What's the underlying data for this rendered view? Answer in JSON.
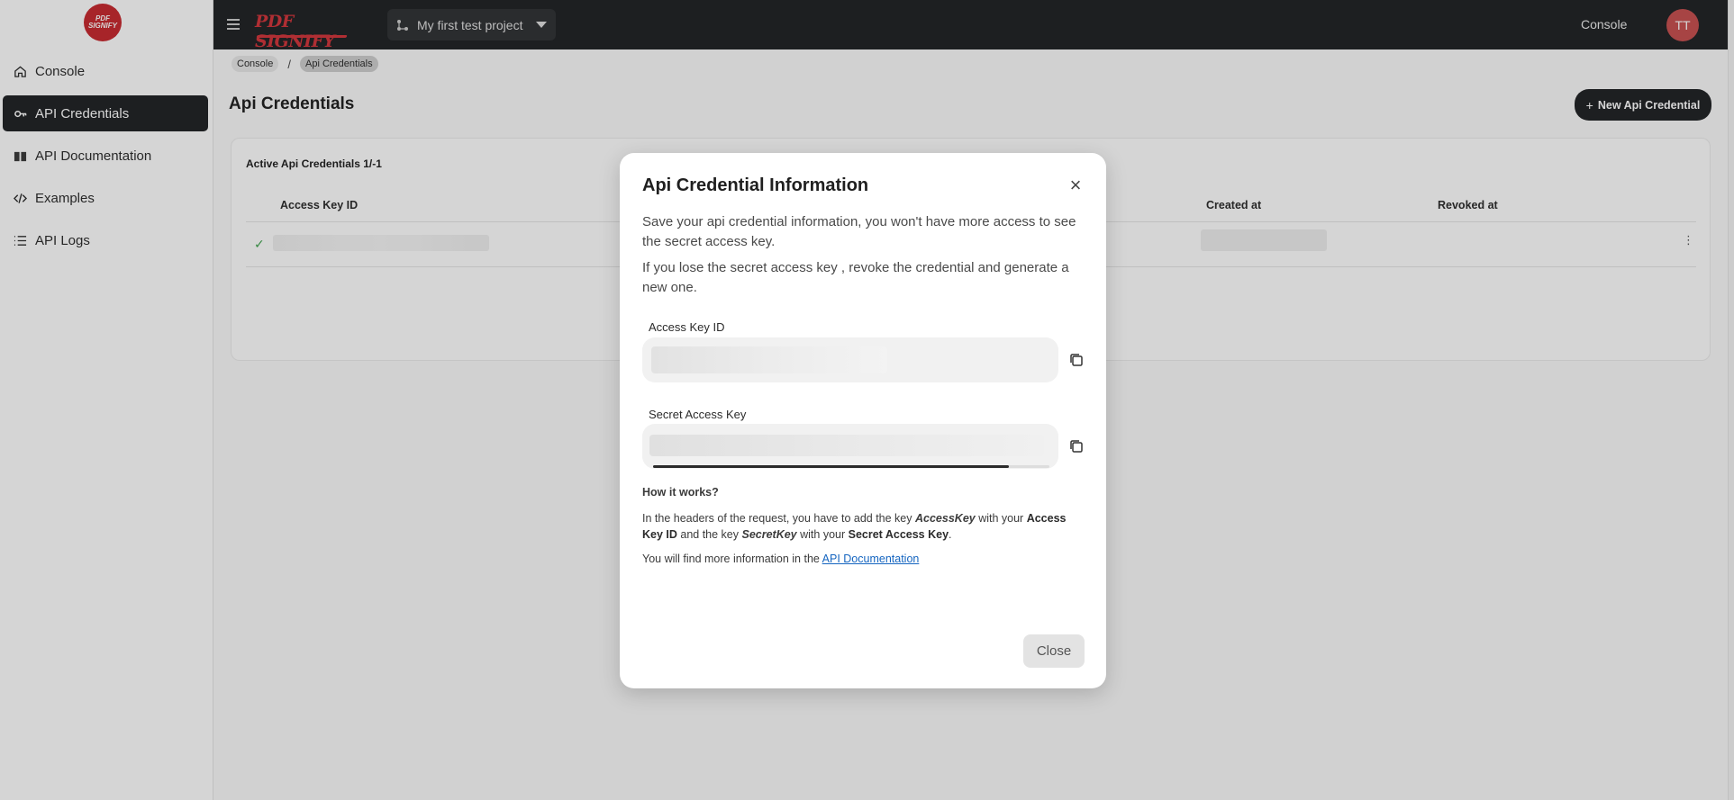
{
  "app": {
    "logo_text": "PDF SIGNIFY",
    "brand_text": "PDF SIGNIFY",
    "project_name": "My first test project",
    "top_console_label": "Console",
    "avatar_initials": "TT",
    "accent_color": "#1f2124",
    "brand_color": "#d2343a"
  },
  "sidebar": {
    "items": [
      {
        "label": "Console",
        "icon": "home-icon"
      },
      {
        "label": "API Credentials",
        "icon": "key-icon",
        "active": true
      },
      {
        "label": "API Documentation",
        "icon": "book-icon"
      },
      {
        "label": "Examples",
        "icon": "code-icon"
      },
      {
        "label": "API Logs",
        "icon": "list-icon"
      }
    ]
  },
  "breadcrumb": {
    "items": [
      "Console",
      "Api Credentials"
    ],
    "separator": "/"
  },
  "page": {
    "title": "Api Credentials",
    "new_button_label": "New Api Credential"
  },
  "table": {
    "card_title": "Active Api Credentials 1/-1",
    "columns": [
      "Access Key ID",
      "Created at",
      "Revoked at"
    ],
    "rows": [
      {
        "status": "✓",
        "menu": "⋮"
      }
    ]
  },
  "modal": {
    "title": "Api Credential Information",
    "close_icon": "×",
    "paragraph1": "Save your api credential information, you won't have more access to see the secret access key.",
    "paragraph2": "If you lose the secret access key , revoke the credential and generate a new one.",
    "access_key_label": "Access Key ID",
    "secret_key_label": "Secret Access Key",
    "how_title": "How it works?",
    "how_text": {
      "part1": "In the headers of the request, you have to add the key ",
      "key1": "AccessKey",
      "part2": " with your ",
      "bold1": "Access Key ID",
      "part3": " and the key ",
      "key2": "SecretKey",
      "part4": " with your ",
      "bold2": "Secret Access Key",
      "part5": "."
    },
    "more_text": "You will find more information in the ",
    "more_link": "API Documentation",
    "close_button": "Close"
  }
}
